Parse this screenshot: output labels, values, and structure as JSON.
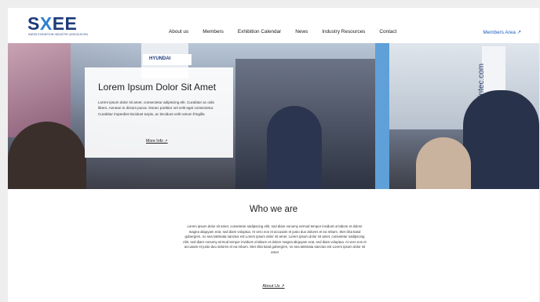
{
  "brand": {
    "logo_text_a": "S",
    "logo_text_x": "X",
    "logo_text_b": "EE",
    "logo_subtitle": "SWISS EXHIBITION INDUSTRY ASSOCIATION"
  },
  "nav": {
    "items": [
      {
        "label": "About us"
      },
      {
        "label": "Members"
      },
      {
        "label": "Exhibition Calendar"
      },
      {
        "label": "News"
      },
      {
        "label": "Industry Resources"
      },
      {
        "label": "Contact"
      }
    ],
    "members_area": "Members Area ↗"
  },
  "hero": {
    "title": "Lorem Ipsum Dolor Sit Amet",
    "text": "Lorem ipsum dolor sit amet, consectetur adipiscing elit. Curabitur ac odio libero. Aenean in dictum purus. Donec porttitor vel velit eget consectetur. Curabitur imperdiet tincidunt turpis, ac tincidunt velit rutrum fringilla",
    "more_label": "More Info ↗",
    "banner_text": "HYUNDAI",
    "side_text": "rintec.com"
  },
  "who": {
    "title": "Who we are",
    "text": "Lorem ipsum dolor sit amet, consetetur sadipscing elitr, sed diam nonumy eirmod tempor invidunt ut labore et dolore magna aliquyam erat, sed diam voluptua. At vero eos et accusam et justo duo dolores et ea rebum. Stet clita kasd gubergren, no sea takimata sanctus est Lorem ipsum dolor sit amet. Lorem ipsum dolor sit amet, consetetur sadipscing elitr, sed diam nonumy eirmod tempor invidunt ut labore et dolore magna aliquyam erat, sed diam voluptua. At vero eos et accusam et justo duo dolores et ea rebum. Stet clita kasd gubergren, no sea takimata sanctus est Lorem ipsum dolor sit amet",
    "more_label": "About Us ↗"
  },
  "colors": {
    "brand_dark": "#1d3a7a",
    "brand_accent": "#2f7fd0",
    "link_blue": "#1e5fbf",
    "page_bg": "#eeeeee"
  }
}
